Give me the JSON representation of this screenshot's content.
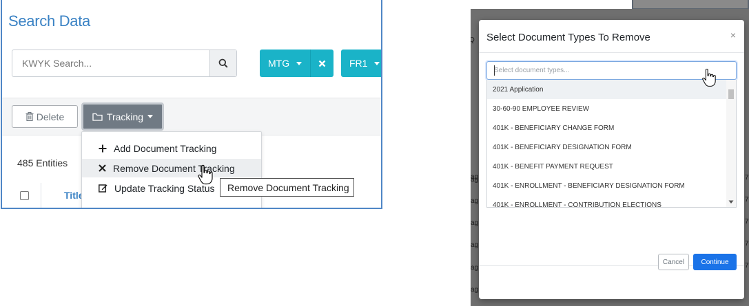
{
  "left": {
    "title": "Search Data",
    "search": {
      "placeholder": "KWYK Search..."
    },
    "chips": [
      {
        "label": "MTG"
      },
      {
        "label": "FR1"
      }
    ],
    "toolbar": {
      "delete_label": "Delete",
      "tracking_label": "Tracking"
    },
    "entities_label": "485 Entities",
    "table": {
      "title_header": "Title"
    },
    "dropdown": {
      "items": [
        {
          "label": "Add Document Tracking",
          "icon": "plus-icon"
        },
        {
          "label": "Remove Document Tracking",
          "icon": "close-icon"
        },
        {
          "label": "Update Tracking Status",
          "icon": "edit-icon"
        }
      ]
    },
    "tooltip": "Remove Document Tracking"
  },
  "right": {
    "modal": {
      "title": "Select Document Types To Remove",
      "close": "×",
      "select_placeholder": "Select document types...",
      "options": [
        "2021 Application",
        "30-60-90 EMPLOYEE REVIEW",
        "401K - BENEFICIARY CHANGE FORM",
        "401K - BENEFICIARY DESIGNATION FORM",
        "401K - BENEFIT PAYMENT REQUEST",
        "401K - ENROLLMENT - BENEFICIARY DESIGNATION FORM",
        "401K - ENROLLMENT - CONTRIBUTION ELECTIONS"
      ],
      "cancel_label": "Cancel",
      "continue_label": "Continue"
    }
  },
  "colors": {
    "accent": "#3a82c4",
    "chip": "#1ab3c8",
    "tracking_button": "#707a84",
    "primary_button": "#1a73e8",
    "overlay": "#6f6f6f"
  }
}
